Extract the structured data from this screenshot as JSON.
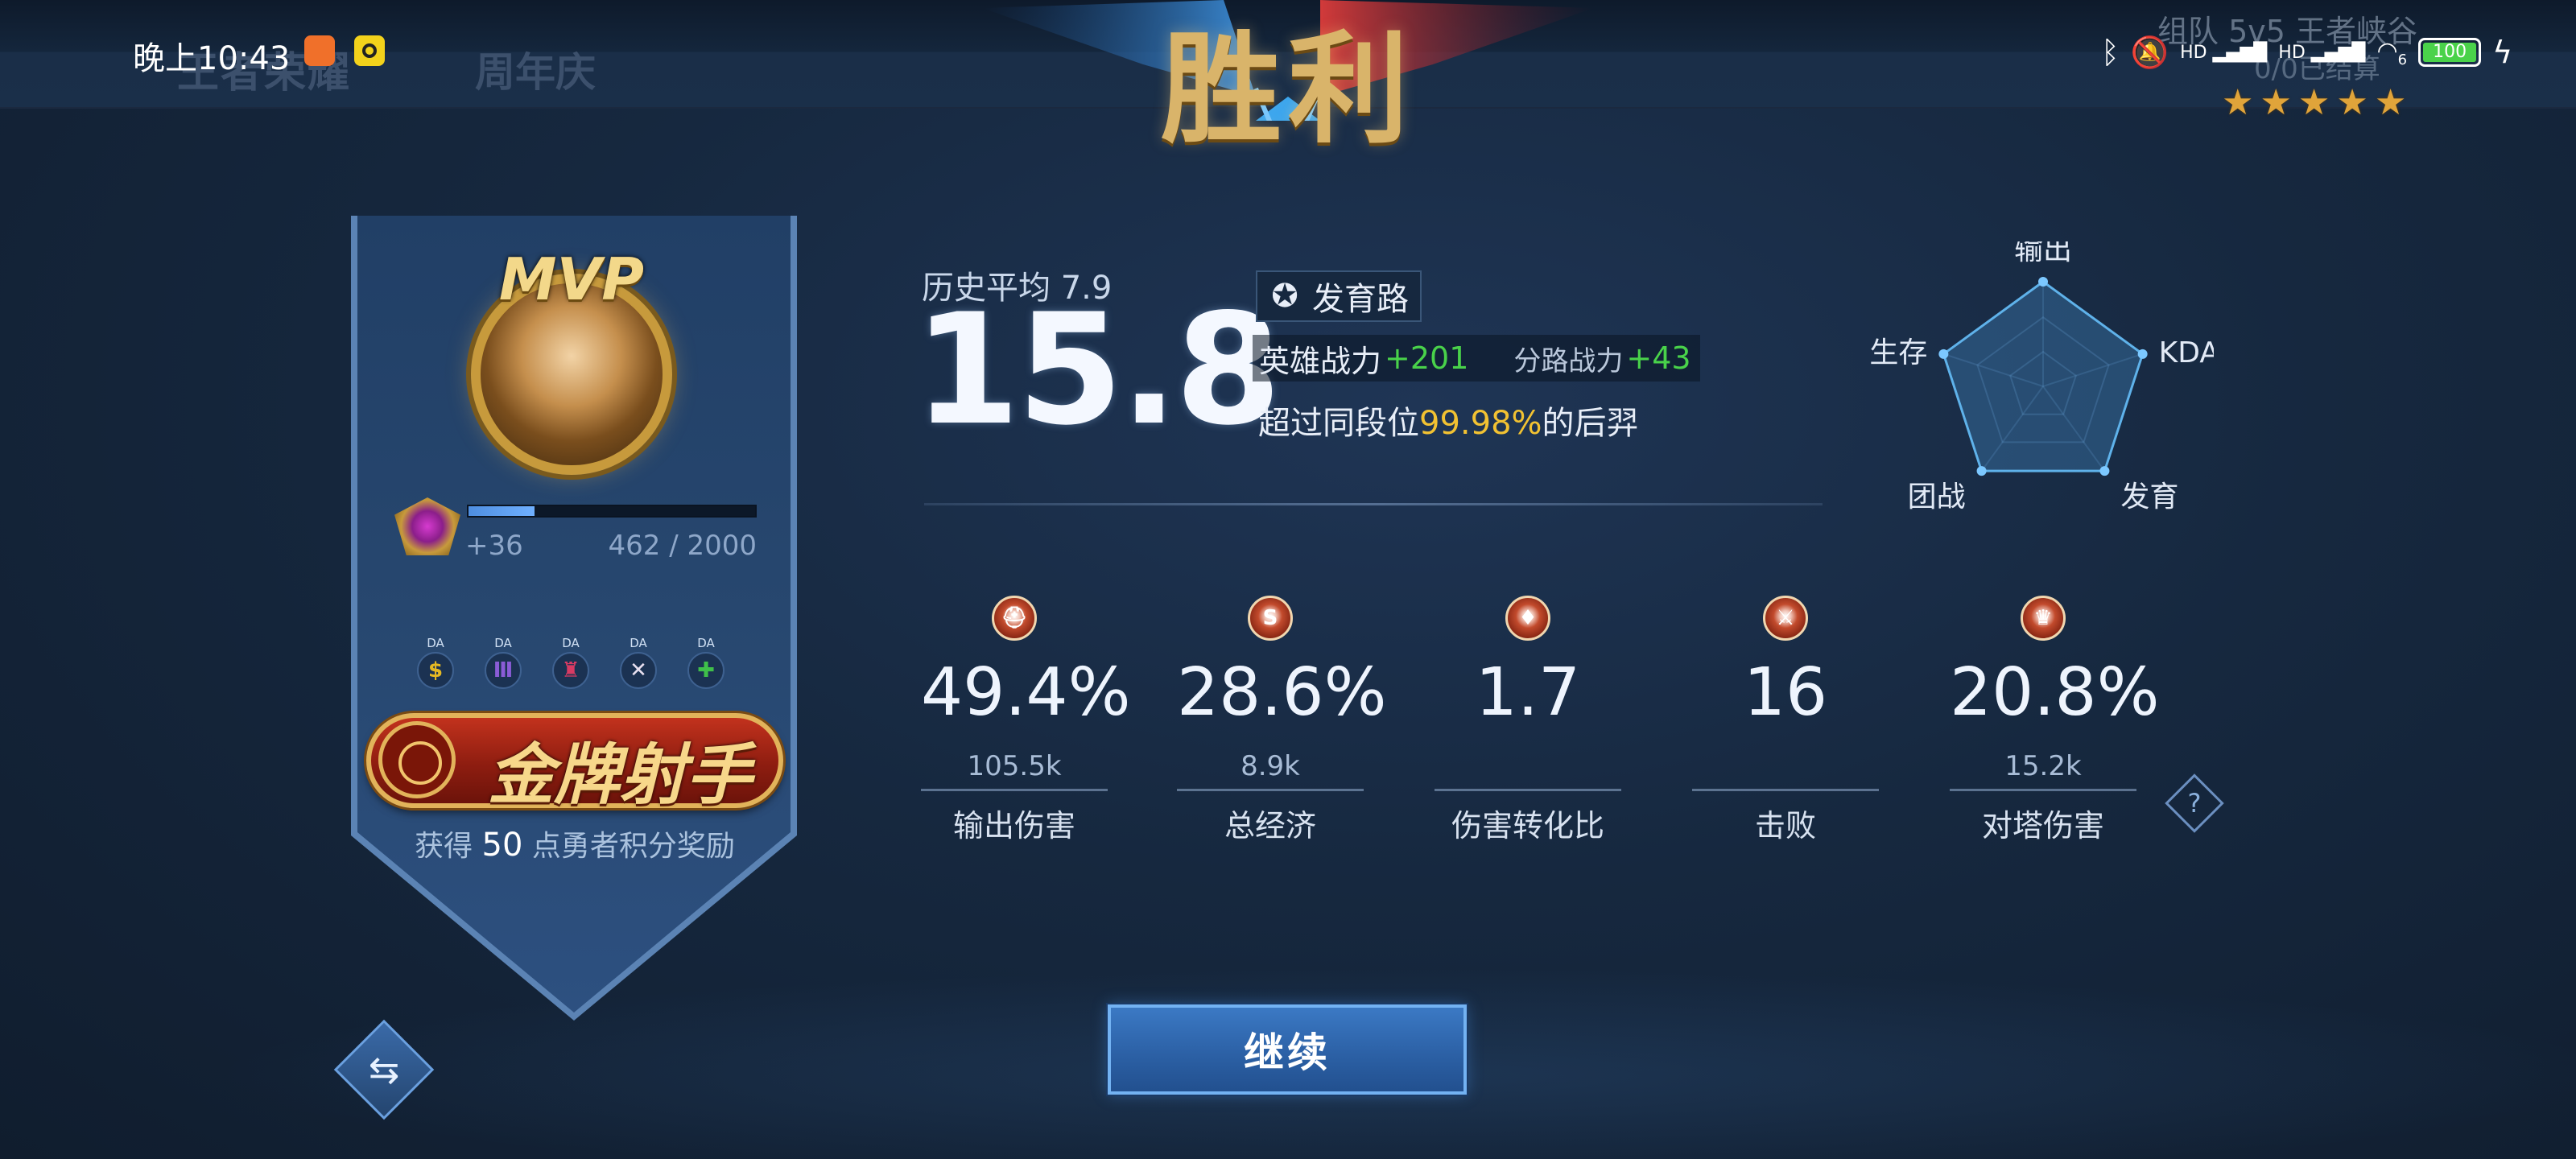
{
  "status_bar": {
    "time": "晚上10:43",
    "battery": "100",
    "signal_1": "HD",
    "signal_2": "HD",
    "wifi_badge": "6"
  },
  "header": {
    "game_logo": "王者荣耀",
    "anniversary": "周年庆",
    "result": "胜利",
    "mode_line1": "组队 5v5 王者峡谷",
    "mode_line2": "0/0已结算",
    "stars": 5
  },
  "player": {
    "mvp": "MVP",
    "rank_gain": "+36",
    "rank_points": "462 / 2000",
    "rank_progress": 0.231,
    "badges": [
      {
        "tag": "DA",
        "glyph": "$",
        "color": "#e5b923"
      },
      {
        "tag": "DA",
        "glyph": "Ⅲ",
        "color": "#8a5cd6"
      },
      {
        "tag": "DA",
        "glyph": "♜",
        "color": "#d83b63"
      },
      {
        "tag": "DA",
        "glyph": "✕",
        "color": "#e8e0f0"
      },
      {
        "tag": "DA",
        "glyph": "✚",
        "color": "#3fbf4a"
      }
    ],
    "title": "金牌射手",
    "reward_prefix": "获得",
    "reward_amount": "50",
    "reward_suffix": "点勇者积分奖励"
  },
  "score": {
    "history_avg": "历史平均 7.9",
    "value": "15.8",
    "lane": "发育路",
    "hero_power_label": "英雄战力",
    "hero_power_value": "+201",
    "lane_power_label": "分路战力",
    "lane_power_value": "+43",
    "exceed_prefix": "超过同段位",
    "exceed_pct": "99.98%",
    "exceed_suffix": "的后羿"
  },
  "radar": {
    "axes": [
      "输出",
      "KDA",
      "发育",
      "团战",
      "生存"
    ],
    "values": [
      1.0,
      1.0,
      1.0,
      1.0,
      1.0
    ]
  },
  "stats": [
    {
      "icon": "damage-icon",
      "glyph": "⛑",
      "value": "49.4%",
      "sub": "105.5k",
      "label": "输出伤害"
    },
    {
      "icon": "economy-icon",
      "glyph": "S",
      "value": "28.6%",
      "sub": "8.9k",
      "label": "总经济"
    },
    {
      "icon": "conversion-icon",
      "glyph": "♦",
      "value": "1.7",
      "sub": "",
      "label": "伤害转化比"
    },
    {
      "icon": "kills-icon",
      "glyph": "⚔",
      "value": "16",
      "sub": "",
      "label": "击败"
    },
    {
      "icon": "tower-icon",
      "glyph": "♛",
      "value": "20.8%",
      "sub": "15.2k",
      "label": "对塔伤害"
    }
  ],
  "help": "?",
  "continue_label": "继续",
  "swap_glyph": "⇆"
}
